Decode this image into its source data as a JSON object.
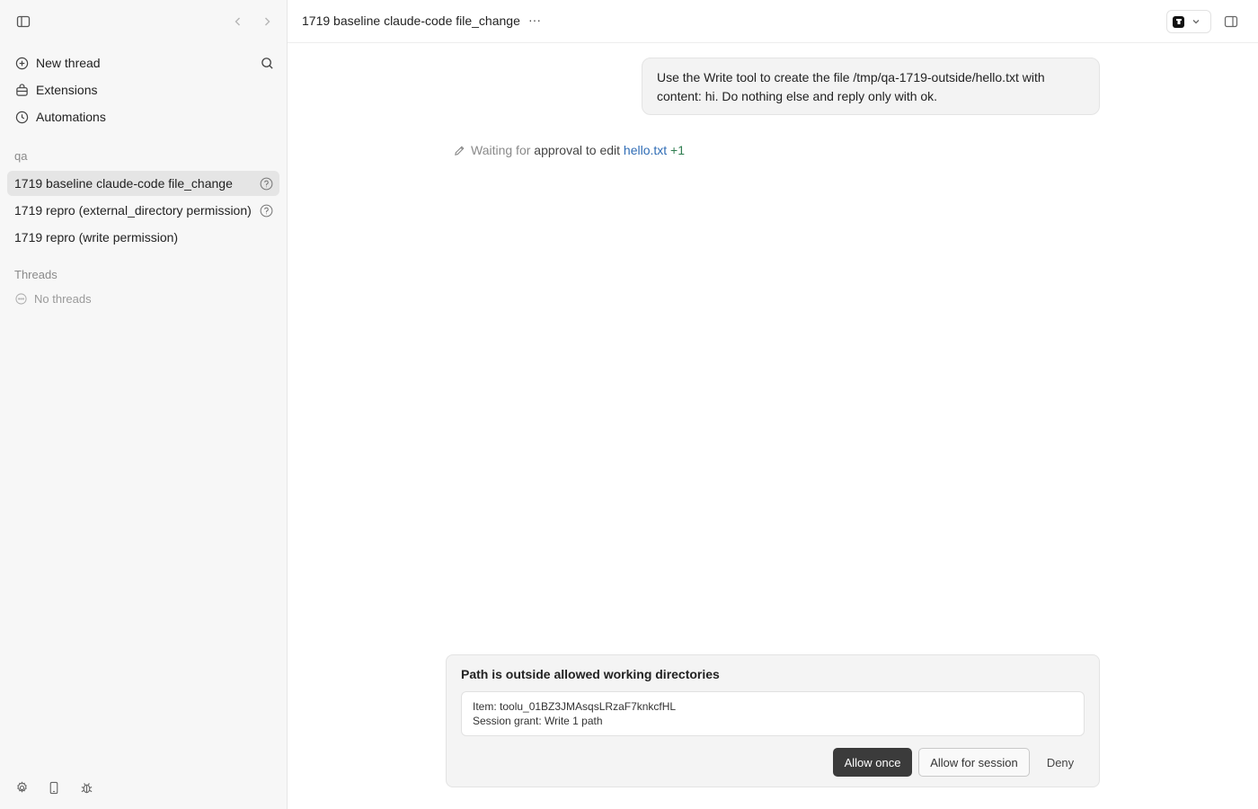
{
  "sidebar": {
    "nav": [
      {
        "label": "New thread",
        "icon": "plus-circle-icon"
      },
      {
        "label": "Extensions",
        "icon": "extensions-icon"
      },
      {
        "label": "Automations",
        "icon": "clock-icon"
      }
    ],
    "project_label": "qa",
    "project_threads": [
      {
        "label": "1719 baseline claude-code file_change",
        "active": true,
        "pending": true
      },
      {
        "label": "1719 repro (external_directory permission)",
        "active": false,
        "pending": true
      },
      {
        "label": "1719 repro (write permission)",
        "active": false,
        "pending": false
      }
    ],
    "threads_label": "Threads",
    "no_threads_label": "No threads"
  },
  "header": {
    "title": "1719 baseline claude-code file_change",
    "more_label": "···"
  },
  "conversation": {
    "user_message": "Use the Write tool to create the file /tmp/qa-1719-outside/hello.txt with content: hi. Do nothing else and reply only with ok.",
    "status": {
      "prefix": "Waiting for",
      "middle": "approval to edit",
      "file": "hello.txt",
      "extra": "+1"
    }
  },
  "approval": {
    "title": "Path is outside allowed working directories",
    "item_line": "Item: toolu_01BZ3JMAsqsLRzaF7knkcfHL",
    "grant_line": "Session grant: Write 1 path",
    "allow_once_label": "Allow once",
    "allow_session_label": "Allow for session",
    "deny_label": "Deny"
  },
  "colors": {
    "accent_link": "#2f6cb5",
    "plus_green": "#2e7d4f",
    "primary_button": "#3b3b3b"
  }
}
